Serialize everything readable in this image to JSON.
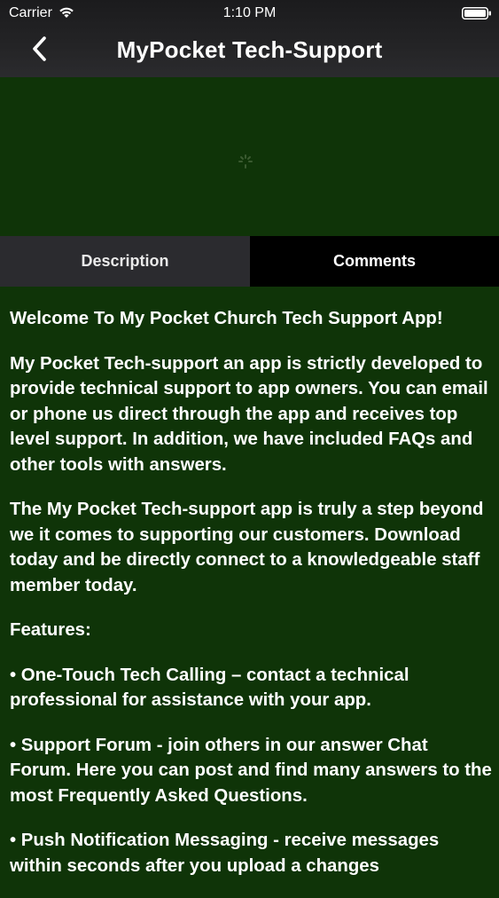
{
  "status_bar": {
    "carrier": "Carrier",
    "time": "1:10 PM",
    "wifi_icon": "wifi-icon",
    "battery_icon": "battery-icon"
  },
  "nav": {
    "back_icon": "chevron-left-icon",
    "title": "MyPocket Tech-Support"
  },
  "banner": {
    "spinner_icon": "loading-spinner-icon"
  },
  "tabs": [
    {
      "label": "Description",
      "selected": true
    },
    {
      "label": "Comments",
      "selected": false
    }
  ],
  "content": {
    "paragraphs": [
      "Welcome To My Pocket Church Tech Support App!",
      "My Pocket Tech-support an app is strictly developed to provide technical support to app owners. You can email or phone us direct through the app and receives top level support. In addition, we have included FAQs and other tools with answers.",
      "The My Pocket Tech-support app is truly a step beyond we it comes to supporting our customers. Download today and be directly connect to a knowledgeable staff member today.",
      "Features:",
      "• One-Touch Tech Calling – contact a technical professional for assistance with your app.",
      "• Support Forum - join others in our answer Chat Forum. Here you can post and find many answers to the most Frequently Asked Questions.",
      "• Push Notification Messaging - receive messages within seconds after you upload a changes"
    ]
  },
  "colors": {
    "background_green": "#0f3408",
    "bar_dark": "#242426",
    "tab_inactive": "#2b2b2f",
    "tab_active": "#000000",
    "text": "#ffffff"
  }
}
